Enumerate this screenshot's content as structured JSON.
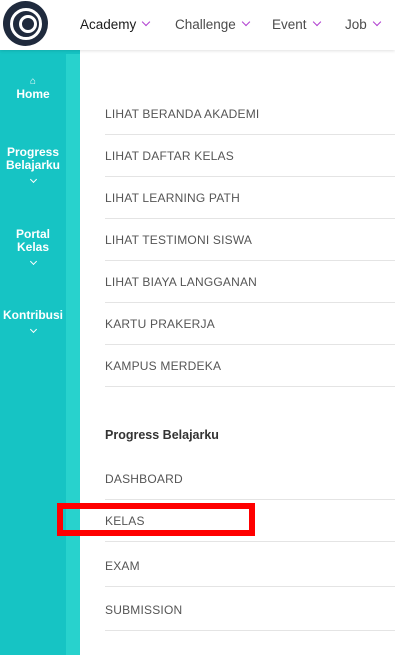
{
  "logo": {
    "icon": "g-logo-icon"
  },
  "topnav": [
    {
      "label": "Academy",
      "active": true
    },
    {
      "label": "Challenge"
    },
    {
      "label": "Event"
    },
    {
      "label": "Job"
    }
  ],
  "sidebar": {
    "home": {
      "icon": "home-icon",
      "label": "Home"
    },
    "progress": {
      "line1": "Progress",
      "line2": "Belajarku"
    },
    "portal": {
      "line1": "Portal",
      "line2": "Kelas"
    },
    "kontribusi": {
      "label": "Kontribusi"
    }
  },
  "menu": {
    "academy_items": [
      "LIHAT BERANDA AKADEMI",
      "LIHAT DAFTAR KELAS",
      "LIHAT LEARNING PATH",
      "LIHAT TESTIMONI SISWA",
      "LIHAT BIAYA LANGGANAN",
      "KARTU PRAKERJA",
      "KAMPUS MERDEKA"
    ],
    "progress_title": "Progress Belajarku",
    "progress_items": [
      "DASHBOARD",
      "KELAS",
      "EXAM",
      "SUBMISSION"
    ]
  },
  "highlight": {
    "target": "KELAS",
    "color": "#ff0000"
  },
  "colors": {
    "sidebar": "#16c4c4",
    "accent_chevron": "#b13fd0"
  }
}
